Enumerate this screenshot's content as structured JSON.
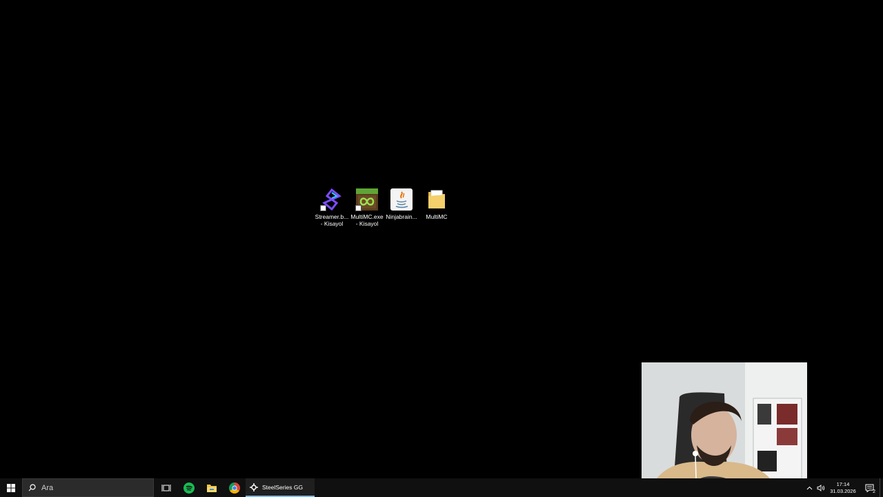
{
  "desktop": {
    "icons": [
      {
        "label": "Streamer.b...\n- Kisayol",
        "icon": "streamerbot-icon",
        "shortcut": true
      },
      {
        "label": "MultiMC.exe\n- Kisayol",
        "icon": "multimc-icon",
        "shortcut": true
      },
      {
        "label": "Ninjabrain...",
        "icon": "java-icon",
        "shortcut": false
      },
      {
        "label": "MultiMC",
        "icon": "folder-icon",
        "shortcut": false
      }
    ]
  },
  "taskbar": {
    "search_placeholder": "Ara",
    "pinned_apps": [
      "task-view-icon",
      "spotify-icon",
      "file-explorer-icon",
      "chrome-icon"
    ],
    "running_app": {
      "label": "SteelSeries GG",
      "icon": "steelseries-icon"
    },
    "clock": {
      "time": "17:14",
      "date": "31.03.2026"
    },
    "notification_count": "2",
    "accent_color": "#76b9ed"
  },
  "webcam": {
    "description_icon": "webcam-overlay"
  }
}
